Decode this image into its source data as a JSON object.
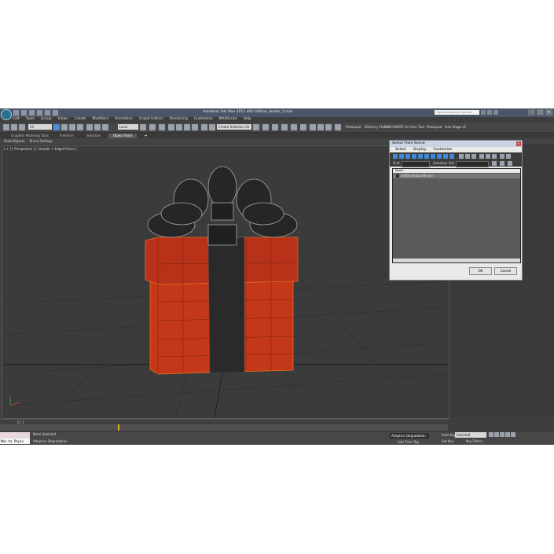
{
  "window": {
    "title": "Autodesk 3ds Max 2012 x64      Giftbox_render_3.max",
    "search_placeholder": "Type a keyword or phrase"
  },
  "menu": [
    "Edit",
    "Tools",
    "Group",
    "Views",
    "Create",
    "Modifiers",
    "Animation",
    "Graph Editors",
    "Rendering",
    "Customize",
    "MAXScript",
    "Help"
  ],
  "toolbar": {
    "filter": "All",
    "coord_system": "Local",
    "named_sel": "Create Selection Se",
    "plugins": [
      "Pixelquad",
      "Delivery Check",
      "CHECKMATE",
      "Air Cam Tool",
      "Pixelquad",
      "lens Stage v5"
    ]
  },
  "ribbon": {
    "tabs": [
      "Graphite Modeling Tools",
      "Freeform",
      "Selection",
      "Object Paint"
    ],
    "active_tab": "Object Paint",
    "sub_items": [
      "Paint Objects",
      "Brush Settings"
    ]
  },
  "viewport": {
    "label": "[ + ] [ Perspective ] [ Smooth + Edged Faces ]"
  },
  "timeline": {
    "frame": "0 / 1"
  },
  "status": {
    "selection": "None Selected",
    "prompt": "Adaptive Degradation",
    "maxscript": "Max to Physx",
    "adaptive_btn": "Adaptive Degradation",
    "add_time_tag": "Add Time Tag",
    "auto_key": "Auto Key",
    "set_key": "Set Key",
    "selected_dropdown": "Selected",
    "key_filters": "Key Filters..."
  },
  "dialog": {
    "title": "Select From Scene",
    "menus": [
      "Select",
      "Display",
      "Customize"
    ],
    "find_label": "Find:",
    "selection_set_label": "Selection Set:",
    "column_name": "Name",
    "items": [
      "GiftBoxRibbonBrown"
    ],
    "ok": "OK",
    "cancel": "Cancel"
  },
  "colors": {
    "viewport_bg": "#3b3b3b",
    "box_red": "#c4381a",
    "ribbon_dark": "#2a2a2a",
    "selection_blue": "#4a8fd6"
  }
}
